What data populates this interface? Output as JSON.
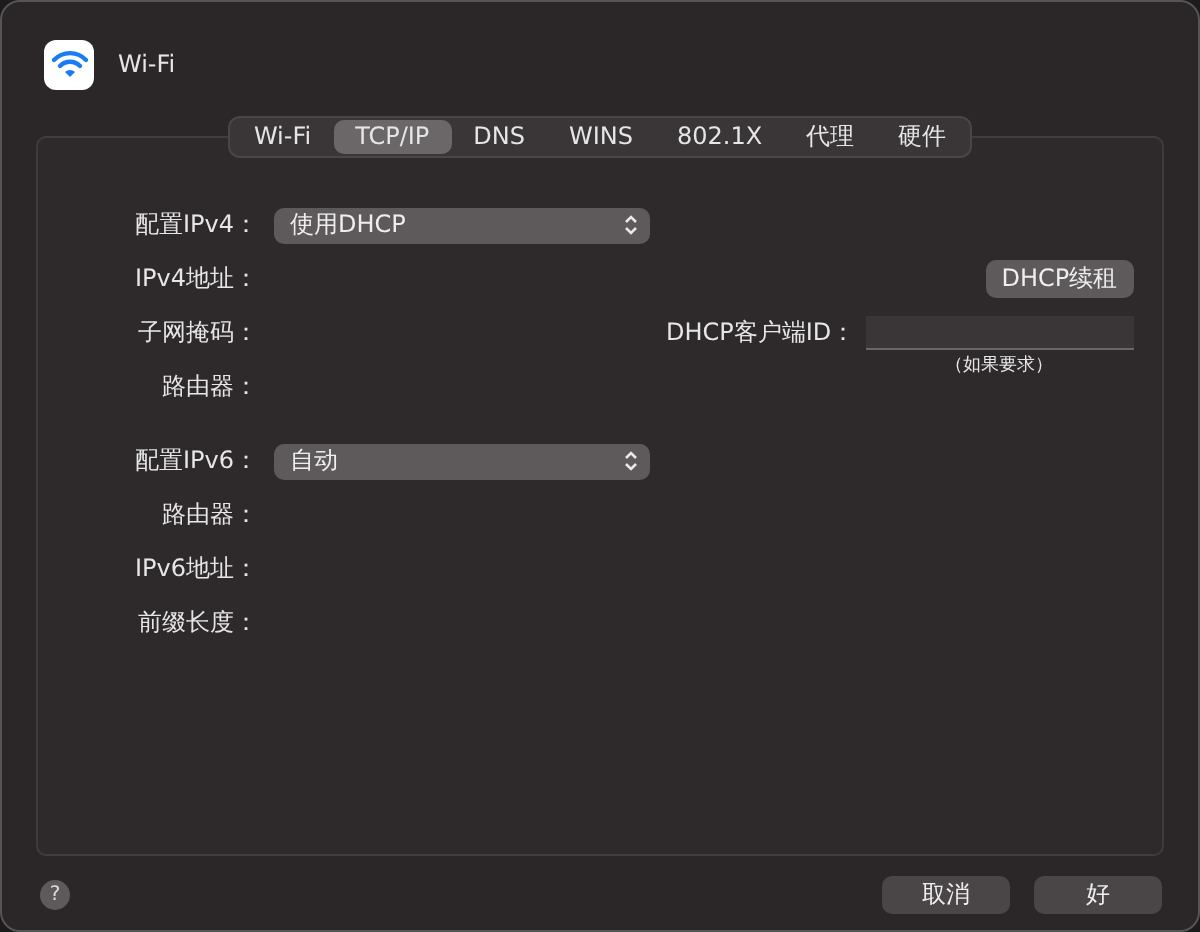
{
  "window": {
    "title": "Wi-Fi"
  },
  "tabs": [
    {
      "label": "Wi-Fi",
      "selected": false
    },
    {
      "label": "TCP/IP",
      "selected": true
    },
    {
      "label": "DNS",
      "selected": false
    },
    {
      "label": "WINS",
      "selected": false
    },
    {
      "label": "802.1X",
      "selected": false
    },
    {
      "label": "代理",
      "selected": false
    },
    {
      "label": "硬件",
      "selected": false
    }
  ],
  "ipv4": {
    "config_label": "配置IPv4：",
    "config_value": "使用DHCP",
    "rows": [
      "IPv4地址：",
      "子网掩码：",
      "路由器："
    ]
  },
  "dhcp": {
    "renew_button": "DHCP续租",
    "client_id_label": "DHCP客户端ID：",
    "client_id_hint": "（如果要求）"
  },
  "ipv6": {
    "config_label": "配置IPv6：",
    "config_value": "自动",
    "rows": [
      "路由器：",
      "IPv6地址：",
      "前缀长度："
    ]
  },
  "help_button": "?",
  "buttons": [
    "取消",
    "好"
  ]
}
